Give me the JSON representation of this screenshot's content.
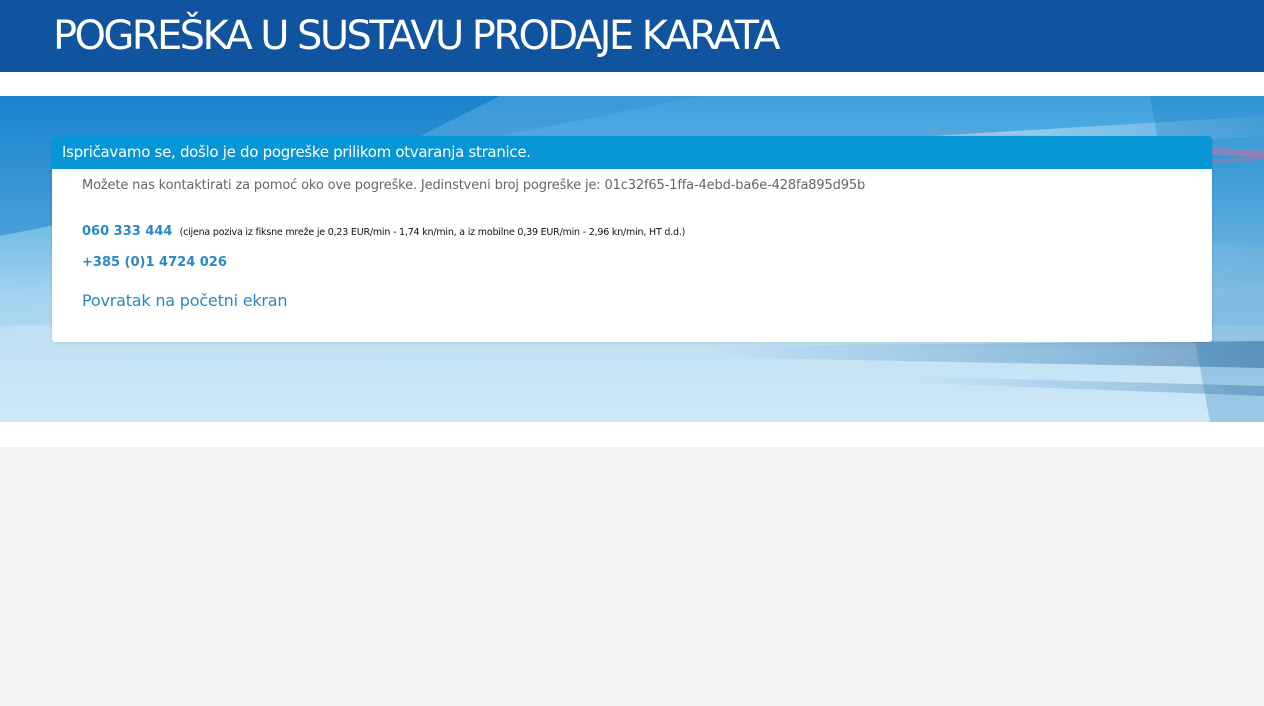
{
  "header": {
    "title": "POGREŠKA U SUSTAVU PRODAJE KARATA"
  },
  "error_panel": {
    "heading": "Ispričavamo se, došlo je do pogreške prilikom otvaranja stranice.",
    "contact_message": "Možete nas kontaktirati za pomoć oko ove pogreške. Jedinstveni broj pogreške je: 01c32f65-1ffa-4ebd-ba6e-428fa895d95b",
    "phone_primary": "060 333 444",
    "phone_primary_note": "(cijena poziva iz fiksne mreže je 0,23 EUR/min - 1,74 kn/min, a iz mobilne 0,39 EUR/min - 2,96 kn/min, HT d.d.)",
    "phone_secondary": "+385 (0)1 4724 026",
    "back_link": "Povratak na početni ekran"
  },
  "colors": {
    "header_bg": "#10539f",
    "panel_heading_bg": "#0695d5",
    "link": "#2a88c6",
    "page_bg": "#f3f3f3"
  }
}
